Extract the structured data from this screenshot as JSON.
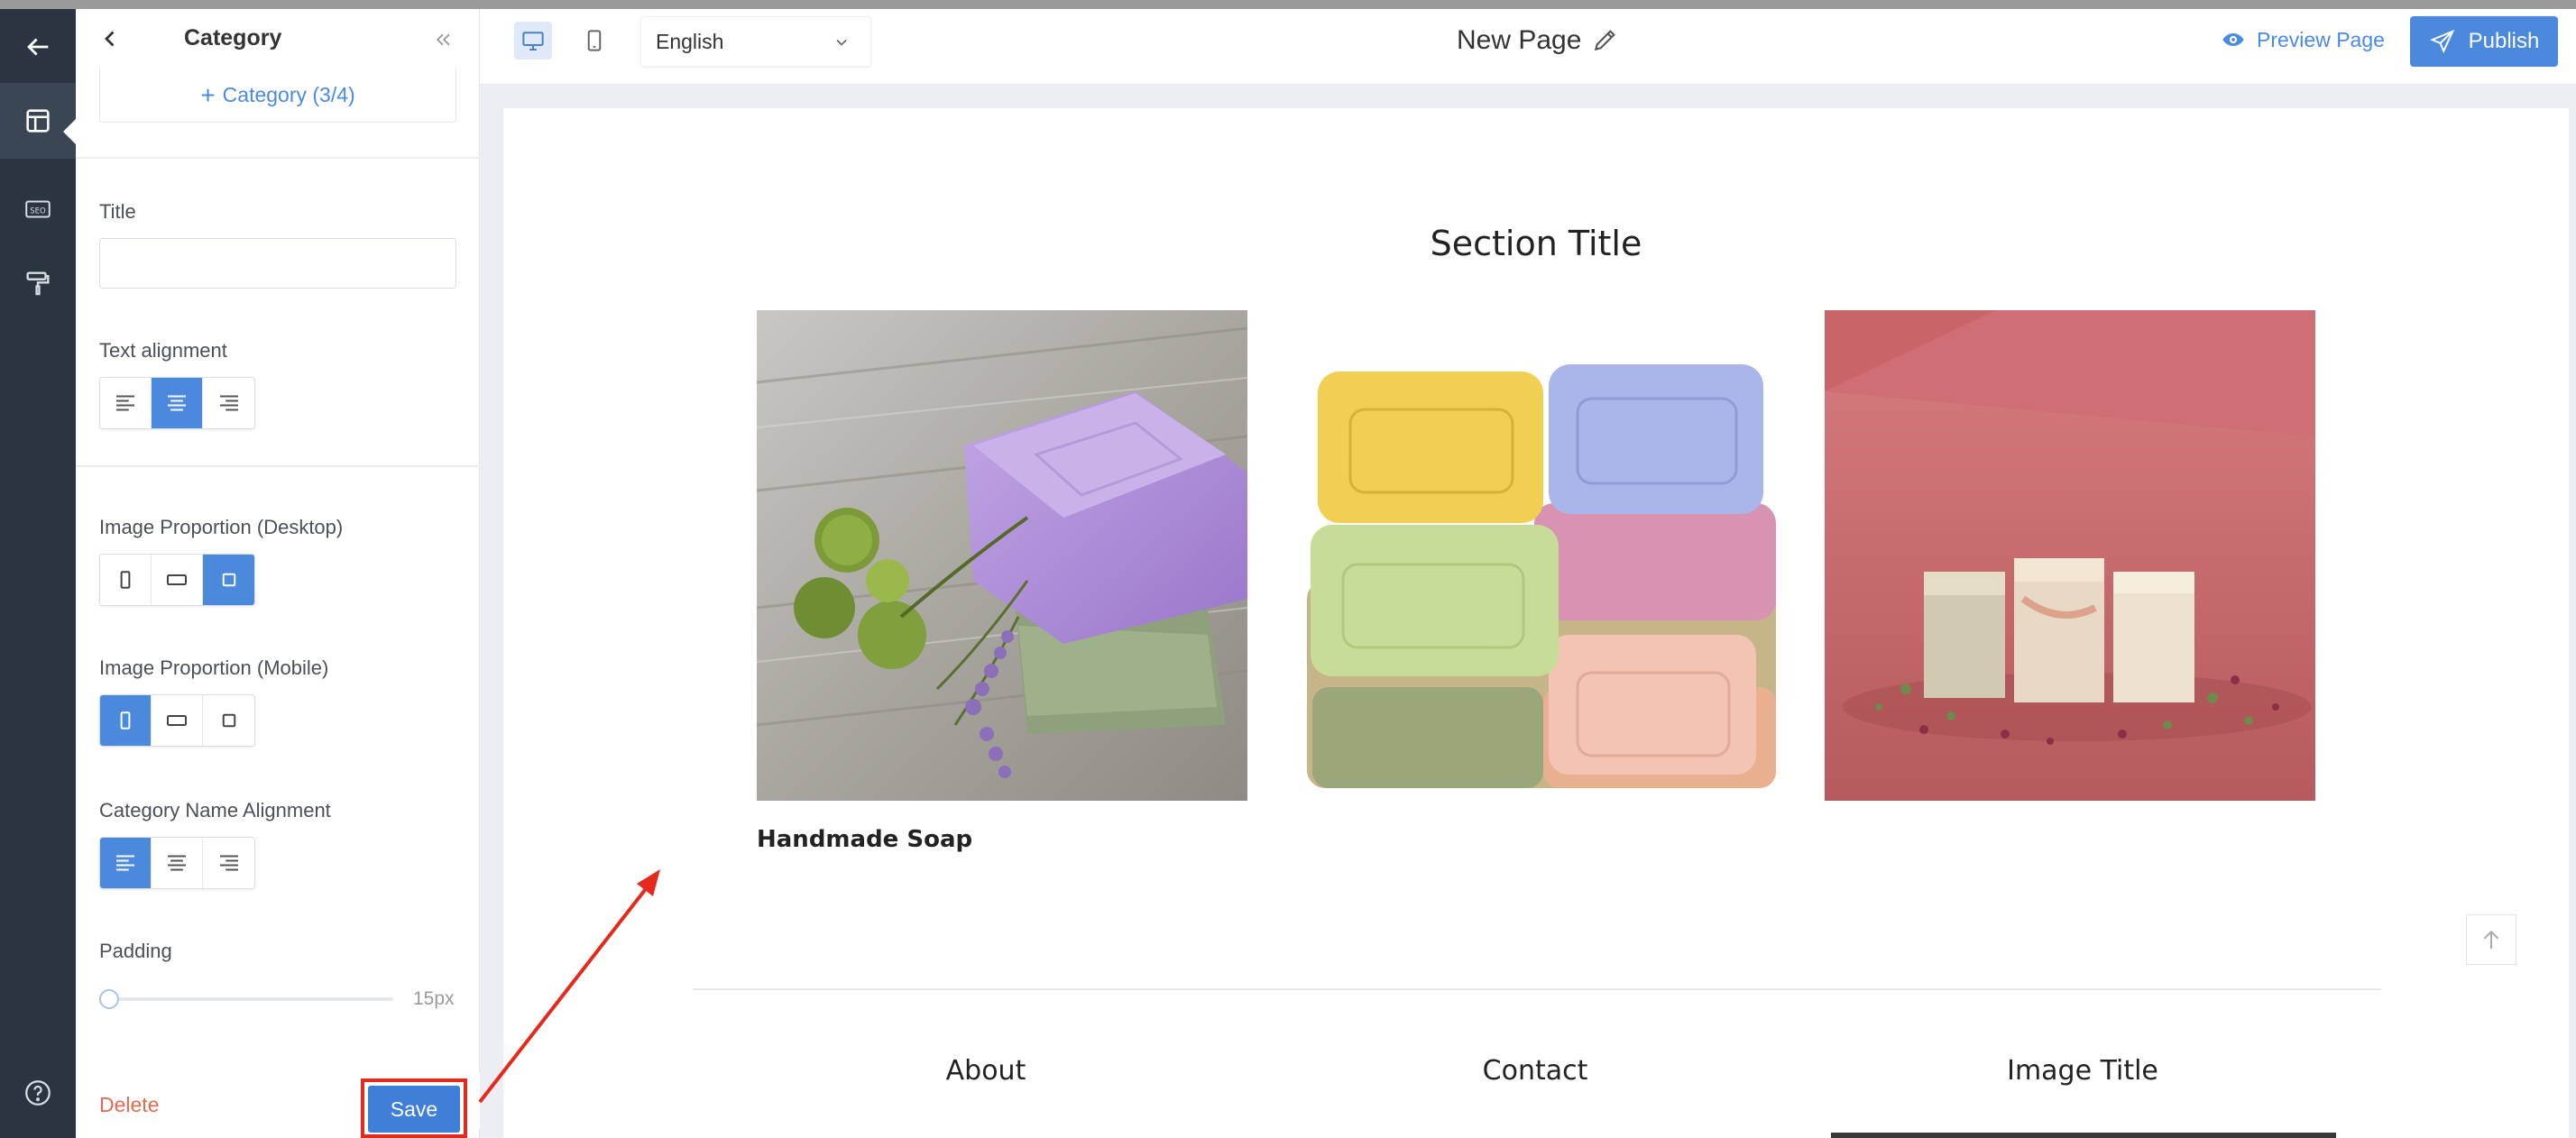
{
  "panel": {
    "title": "Category",
    "add_category": "Category (3/4)",
    "title_label": "Title",
    "title_value": "",
    "text_alignment_label": "Text alignment",
    "image_proportion_desktop_label": "Image Proportion (Desktop)",
    "image_proportion_mobile_label": "Image Proportion (Mobile)",
    "category_name_alignment_label": "Category Name Alignment",
    "padding_label": "Padding",
    "padding_value": "15px",
    "delete_label": "Delete",
    "save_label": "Save",
    "selected": {
      "text_alignment": "center",
      "image_proportion_desktop": "square",
      "image_proportion_mobile": "portrait",
      "category_name_alignment": "left"
    }
  },
  "toolbar": {
    "language": "English",
    "page_name": "New Page",
    "preview_label": "Preview Page",
    "publish_label": "Publish",
    "view_mode": "desktop"
  },
  "canvas": {
    "section_title": "Section Title",
    "categories": [
      {
        "name": "Handmade Soap"
      },
      {
        "name": ""
      },
      {
        "name": ""
      }
    ],
    "footer_columns": [
      "About",
      "Contact",
      "Image Title"
    ]
  },
  "colors": {
    "accent": "#4a89dc",
    "rail": "#2b3542",
    "annotation": "#e6291d",
    "delete": "#e86a4e"
  }
}
